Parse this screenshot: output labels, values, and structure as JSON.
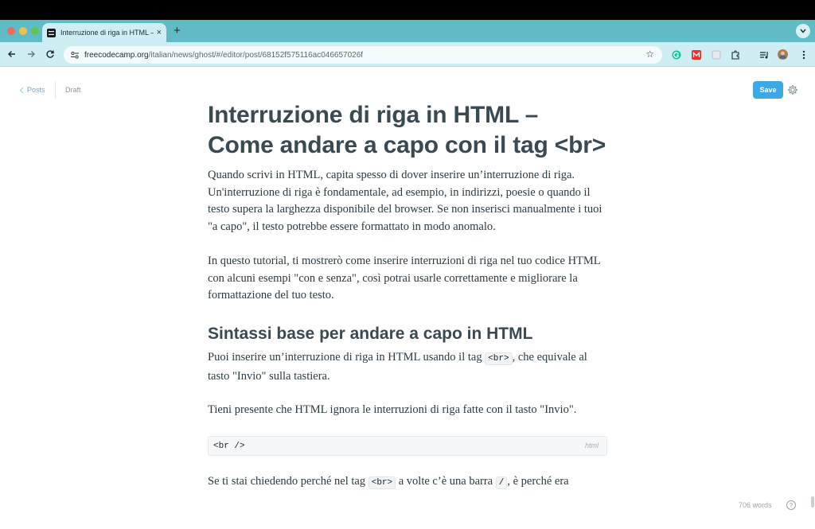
{
  "browser": {
    "tab": {
      "title": "Interruzione di riga in HTML – ",
      "close": "×"
    },
    "new_tab": "+",
    "url_host": "freecodecamp.org",
    "url_path": "/italian/news/ghost/#/editor/post/68152f575116ac046657026f",
    "star": "☆"
  },
  "editor": {
    "back_label": "Posts",
    "status": "Draft",
    "save_label": "Save",
    "title": "Interruzione di riga in HTML – Come andare a capo con il tag <br>",
    "paragraph_1": "Quando scrivi in HTML, capita spesso di dover inserire un’interruzione di riga. Un'interruzione di riga è fondamentale, ad esempio, in indirizzi, poesie o quando il testo supera la larghezza disponibile del browser. Se non inserisci manualmente i tuoi \"a capo\", il testo potrebbe essere formattato in modo anomalo.",
    "paragraph_2": "In questo tutorial, ti mostrerò come inserire interruzioni di riga nel tuo codice HTML con alcuni esempi \"con e senza\", così potrai usarle correttamente e migliorare la formattazione del tuo testo.",
    "heading_1": "Sintassi base per andare a capo in HTML",
    "paragraph_3_a": "Puoi inserire un’interruzione di riga in HTML usando il tag ",
    "paragraph_3_code": "<br>",
    "paragraph_3_b": ", che equivale al tasto \"Invio\" sulla tastiera.",
    "paragraph_4": "Tieni presente che HTML ignora le interruzioni di riga fatte con il tasto \"Invio\".",
    "code_block": {
      "code": "<br />",
      "lang": "html"
    },
    "paragraph_5_a": "Se ti stai chiedendo perché nel tag ",
    "paragraph_5_code_1": "<br>",
    "paragraph_5_b": " a volte c’è una barra ",
    "paragraph_5_code_2": "/",
    "paragraph_5_c": ", è perché era",
    "word_count": "706 words",
    "help": "?"
  }
}
